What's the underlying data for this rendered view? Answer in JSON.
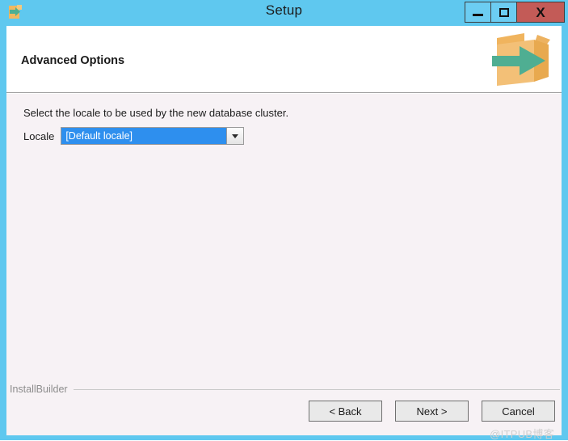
{
  "window": {
    "title": "Setup",
    "app_icon": "box-arrow-icon",
    "frame_color": "#5fc8ef",
    "controls": [
      {
        "name": "minimize",
        "glyph": "minimize-icon",
        "label": ""
      },
      {
        "name": "maximize",
        "glyph": "maximize-icon",
        "label": ""
      },
      {
        "name": "close",
        "glyph": "close-icon",
        "label": "X"
      }
    ],
    "close_color": "#c35b57"
  },
  "header": {
    "title": "Advanced Options",
    "logo_icon": "box-with-green-arrow-logo"
  },
  "main": {
    "instruction": "Select the locale to be used by the new database cluster.",
    "field": {
      "label": "Locale",
      "value": "[Default locale]",
      "placeholder": "[Default locale]",
      "selected_color": "#2e8fee",
      "arrow_icon": "chevron-down-icon"
    }
  },
  "footer": {
    "brand": "InstallBuilder",
    "buttons": [
      {
        "name": "back",
        "label": "< Back"
      },
      {
        "name": "next",
        "label": "Next >"
      },
      {
        "name": "cancel",
        "label": "Cancel"
      }
    ],
    "watermark": "@ITPUB博客"
  }
}
